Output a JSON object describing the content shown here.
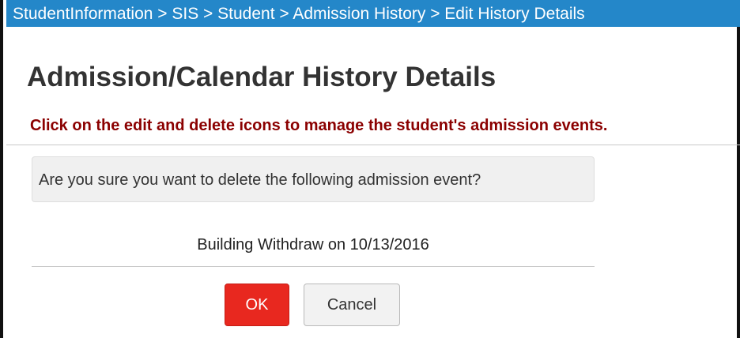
{
  "breadcrumb": {
    "text": "StudentInformation > SIS > Student > Admission History > Edit History Details",
    "items": [
      "StudentInformation",
      "SIS",
      "Student",
      "Admission History",
      "Edit History Details"
    ],
    "separator": ">"
  },
  "page": {
    "title": "Admission/Calendar History Details",
    "instruction": "Click on the edit and delete icons to manage the student's admission events."
  },
  "dialog": {
    "question": "Are you sure you want to delete the following admission event?",
    "event_text": "Building Withdraw on 10/13/2016",
    "ok_label": "OK",
    "cancel_label": "Cancel"
  },
  "colors": {
    "breadcrumb_bg": "#2487c9",
    "instruction_text": "#8b0000",
    "ok_button_bg": "#e8281f",
    "cancel_button_bg": "#f2f2f2"
  }
}
